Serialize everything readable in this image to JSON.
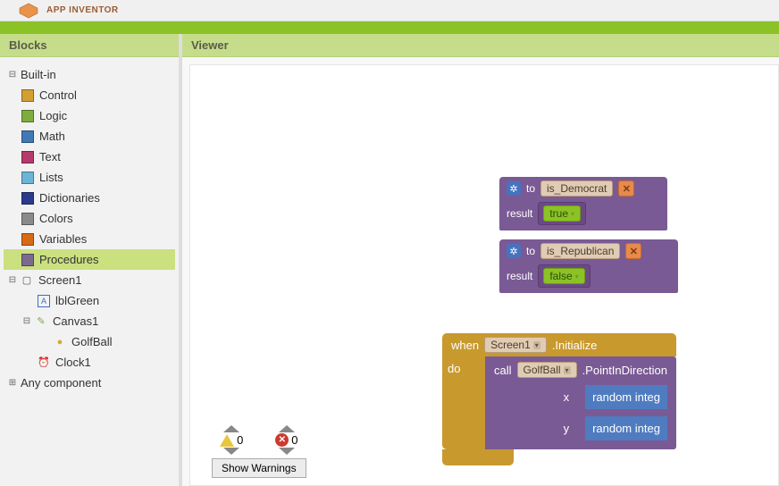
{
  "header": {
    "app_name": "APP INVENTOR"
  },
  "panels": {
    "blocks_title": "Blocks",
    "viewer_title": "Viewer"
  },
  "tree": {
    "builtin": "Built-in",
    "items": [
      "Control",
      "Logic",
      "Math",
      "Text",
      "Lists",
      "Dictionaries",
      "Colors",
      "Variables",
      "Procedures"
    ],
    "screen": "Screen1",
    "lblGreen": "lblGreen",
    "canvas": "Canvas1",
    "golfball": "GolfBall",
    "clock": "Clock1",
    "any": "Any component"
  },
  "blocks": {
    "to": "to",
    "result": "result",
    "proc1_name": "is_Democrat",
    "proc1_value": "true",
    "proc2_name": "is_Republican",
    "proc2_value": "false",
    "when": "when",
    "when_target": "Screen1",
    "when_event": ".Initialize",
    "do": "do",
    "call": "call",
    "call_target": "GolfBall",
    "call_method": ".PointInDirection",
    "arg_x": "x",
    "arg_y": "y",
    "random": "random integ"
  },
  "warnings": {
    "warn_count": "0",
    "err_count": "0",
    "button": "Show Warnings"
  }
}
